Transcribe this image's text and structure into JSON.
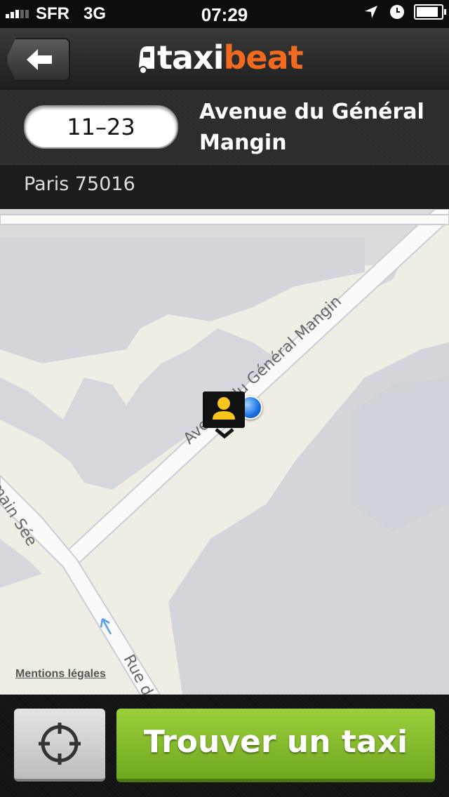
{
  "status_bar": {
    "carrier": "SFR",
    "network": "3G",
    "time": "07:29"
  },
  "nav": {
    "logo_part1": "taxi",
    "logo_part2": "beat",
    "brand_color": "#f26a1f"
  },
  "address": {
    "number": "11–23",
    "street": "Avenue du Général Mangin",
    "city": "Paris 75016"
  },
  "map": {
    "street_main": "Avenue du Général Mangin",
    "street_side": "Rue Germain Sée",
    "street_side_bottom": "Rue d",
    "legal_link": "Mentions légales"
  },
  "bottom": {
    "find_button": "Trouver un taxi",
    "find_button_color": "#8cc232",
    "locate_icon": "crosshair-icon"
  }
}
